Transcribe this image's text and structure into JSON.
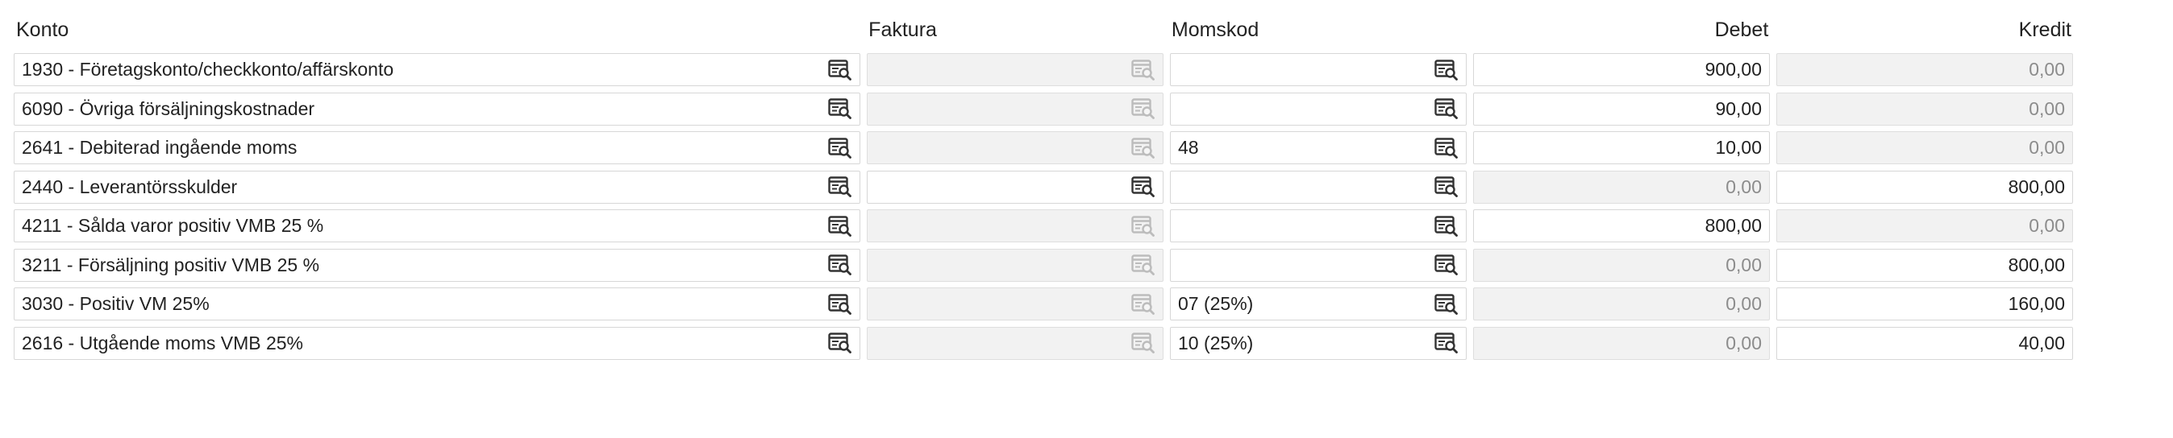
{
  "headers": {
    "konto": "Konto",
    "faktura": "Faktura",
    "momskod": "Momskod",
    "debet": "Debet",
    "kredit": "Kredit"
  },
  "lookup_icon": "search-list-icon",
  "rows": [
    {
      "konto": "1930 - Företagskonto/checkkonto/affärskonto",
      "faktura": "",
      "faktura_enabled": false,
      "momskod": "",
      "debet": "900,00",
      "debet_enabled": true,
      "kredit": "0,00",
      "kredit_enabled": false
    },
    {
      "konto": "6090 - Övriga försäljningskostnader",
      "faktura": "",
      "faktura_enabled": false,
      "momskod": "",
      "debet": "90,00",
      "debet_enabled": true,
      "kredit": "0,00",
      "kredit_enabled": false
    },
    {
      "konto": "2641 - Debiterad ingående moms",
      "faktura": "",
      "faktura_enabled": false,
      "momskod": "48",
      "debet": "10,00",
      "debet_enabled": true,
      "kredit": "0,00",
      "kredit_enabled": false
    },
    {
      "konto": "2440 - Leverantörsskulder",
      "faktura": "",
      "faktura_enabled": true,
      "momskod": "",
      "debet": "0,00",
      "debet_enabled": false,
      "kredit": "800,00",
      "kredit_enabled": true
    },
    {
      "konto": "4211 - Sålda varor positiv VMB 25 %",
      "faktura": "",
      "faktura_enabled": false,
      "momskod": "",
      "debet": "800,00",
      "debet_enabled": true,
      "kredit": "0,00",
      "kredit_enabled": false
    },
    {
      "konto": "3211 - Försäljning positiv VMB 25 %",
      "faktura": "",
      "faktura_enabled": false,
      "momskod": "",
      "debet": "0,00",
      "debet_enabled": false,
      "kredit": "800,00",
      "kredit_enabled": true
    },
    {
      "konto": "3030 - Positiv VM 25%",
      "faktura": "",
      "faktura_enabled": false,
      "momskod": "07 (25%)",
      "debet": "0,00",
      "debet_enabled": false,
      "kredit": "160,00",
      "kredit_enabled": true
    },
    {
      "konto": "2616 - Utgående moms VMB 25%",
      "faktura": "",
      "faktura_enabled": false,
      "momskod": "10 (25%)",
      "debet": "0,00",
      "debet_enabled": false,
      "kredit": "40,00",
      "kredit_enabled": true
    }
  ]
}
